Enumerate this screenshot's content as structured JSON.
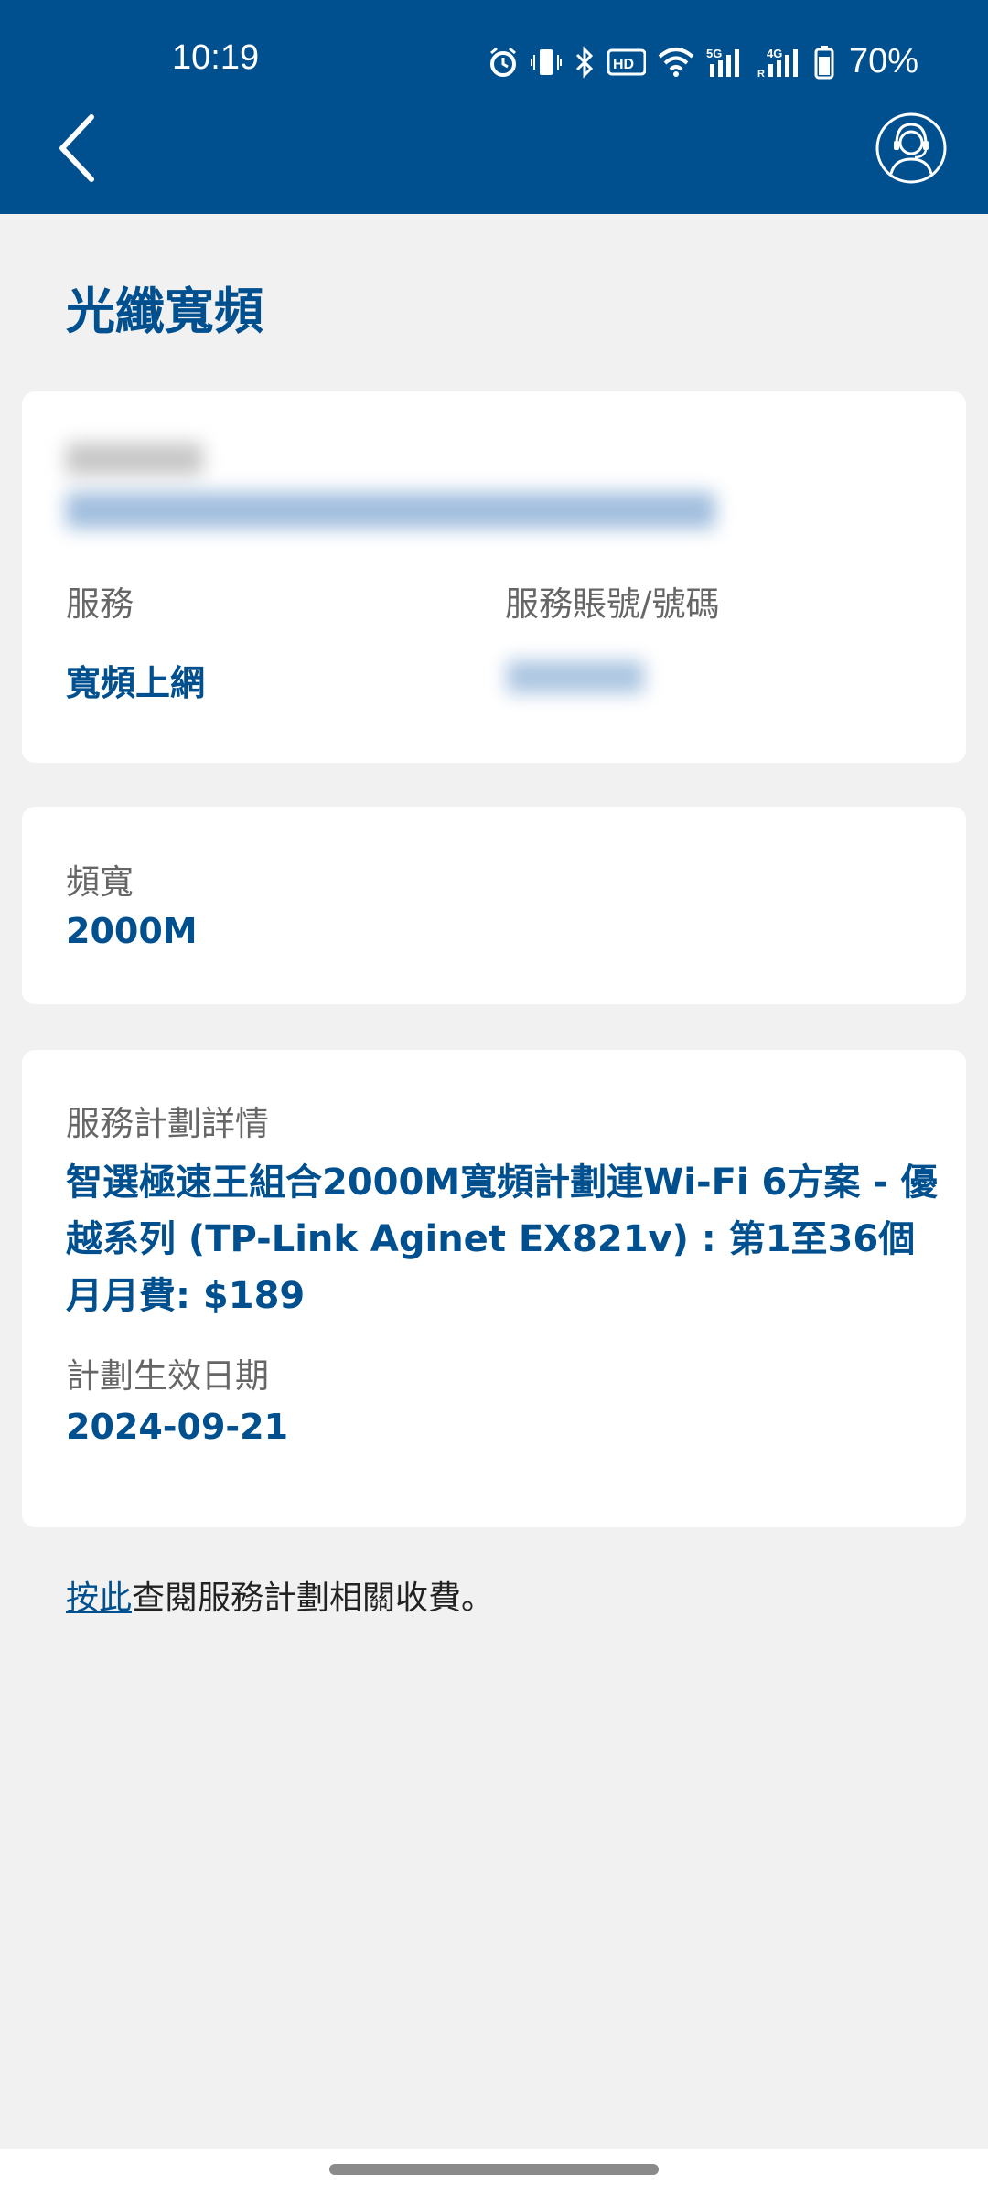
{
  "status_bar": {
    "time": "10:19",
    "battery": "70%",
    "icons": [
      "alarm-icon",
      "vibrate-icon",
      "bluetooth-icon",
      "hd-voice-icon",
      "wifi-icon",
      "signal-5g-icon",
      "signal-4g-roaming-icon",
      "battery-icon"
    ]
  },
  "header": {
    "back_icon": "chevron-left-icon",
    "support_icon": "customer-service-headset-icon"
  },
  "page": {
    "title": "光纖寬頻"
  },
  "service_card": {
    "service_label": "服務",
    "service_value": "寬頻上網",
    "account_label": "服務賬號/號碼"
  },
  "bandwidth_card": {
    "label": "頻寬",
    "value": "2000M"
  },
  "plan_card": {
    "detail_label": "服務計劃詳情",
    "detail_value": "智選極速王組合2000M寬頻計劃連Wi-Fi 6方案 - 優越系列 (TP-Link Aginet EX821v) : 第1至36個月月費: $189",
    "effective_label": "計劃生效日期",
    "effective_value": "2024-09-21"
  },
  "footer": {
    "link_text": "按此",
    "text": "查閱服務計劃相關收費。"
  },
  "colors": {
    "brand_blue": "#00508f",
    "background": "#f1f1f1",
    "card": "#ffffff",
    "label_gray": "#666666"
  }
}
